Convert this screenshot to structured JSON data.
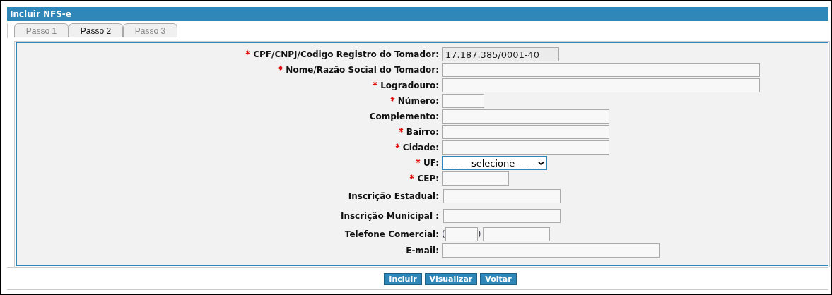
{
  "window": {
    "title": "Incluir NFS-e"
  },
  "tabs": [
    {
      "label": "Passo 1",
      "selected": false
    },
    {
      "label": "Passo 2",
      "selected": true
    },
    {
      "label": "Passo 3",
      "selected": false
    }
  ],
  "fields": [
    {
      "label": "CPF/CNPJ/Codigo Registro do Tomador:",
      "required": true,
      "kind": "text",
      "value": "17.187.385/0001-40",
      "disabled": true
    },
    {
      "label": "Nome/Razão Social do Tomador:",
      "required": true,
      "kind": "text",
      "disabled": false
    },
    {
      "label": "Logradouro:",
      "required": true,
      "kind": "text",
      "disabled": false
    },
    {
      "label": "Número:",
      "required": true,
      "kind": "text",
      "disabled": false
    },
    {
      "label": "Complemento:",
      "required": false,
      "kind": "text",
      "disabled": false
    },
    {
      "label": "Bairro:",
      "required": true,
      "kind": "text",
      "disabled": false
    },
    {
      "label": "Cidade:",
      "required": true,
      "kind": "text",
      "disabled": false
    },
    {
      "label": "UF:",
      "required": true,
      "kind": "select",
      "value": "------- selecione -----",
      "disabled": false
    },
    {
      "label": "CEP:",
      "required": true,
      "kind": "text",
      "disabled": false
    },
    {
      "label": "Inscrição Estadual:",
      "required": false,
      "kind": "text",
      "disabled": false
    },
    {
      "label": "Inscrição Municipal :",
      "required": false,
      "kind": "text",
      "disabled": false
    },
    {
      "label": "Telefone Comercial:",
      "required": false,
      "kind": "phone",
      "open": "(",
      "close": ")",
      "disabled": false
    },
    {
      "label": "E-mail:",
      "required": false,
      "kind": "text",
      "disabled": false
    }
  ],
  "buttons": [
    "Incluir",
    "Visualizar",
    "Voltar"
  ]
}
